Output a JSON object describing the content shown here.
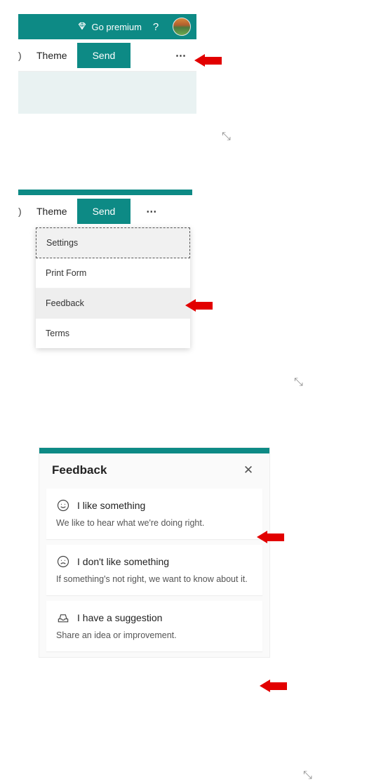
{
  "header": {
    "premium_label": "Go premium",
    "help_glyph": "?"
  },
  "toolbar": {
    "theme_label": "Theme",
    "send_label": "Send",
    "more_glyph": "⋯"
  },
  "dropdown": {
    "settings": "Settings",
    "print_form": "Print Form",
    "feedback": "Feedback",
    "terms": "Terms"
  },
  "feedback_panel": {
    "title": "Feedback",
    "close_glyph": "✕",
    "cards": [
      {
        "title": "I like something",
        "sub": "We like to hear what we're doing right."
      },
      {
        "title": "I don't like something",
        "sub": "If something's not right, we want to know about it."
      },
      {
        "title": "I have a suggestion",
        "sub": "Share an idea or improvement."
      }
    ]
  },
  "resize_glyph": "⤡"
}
